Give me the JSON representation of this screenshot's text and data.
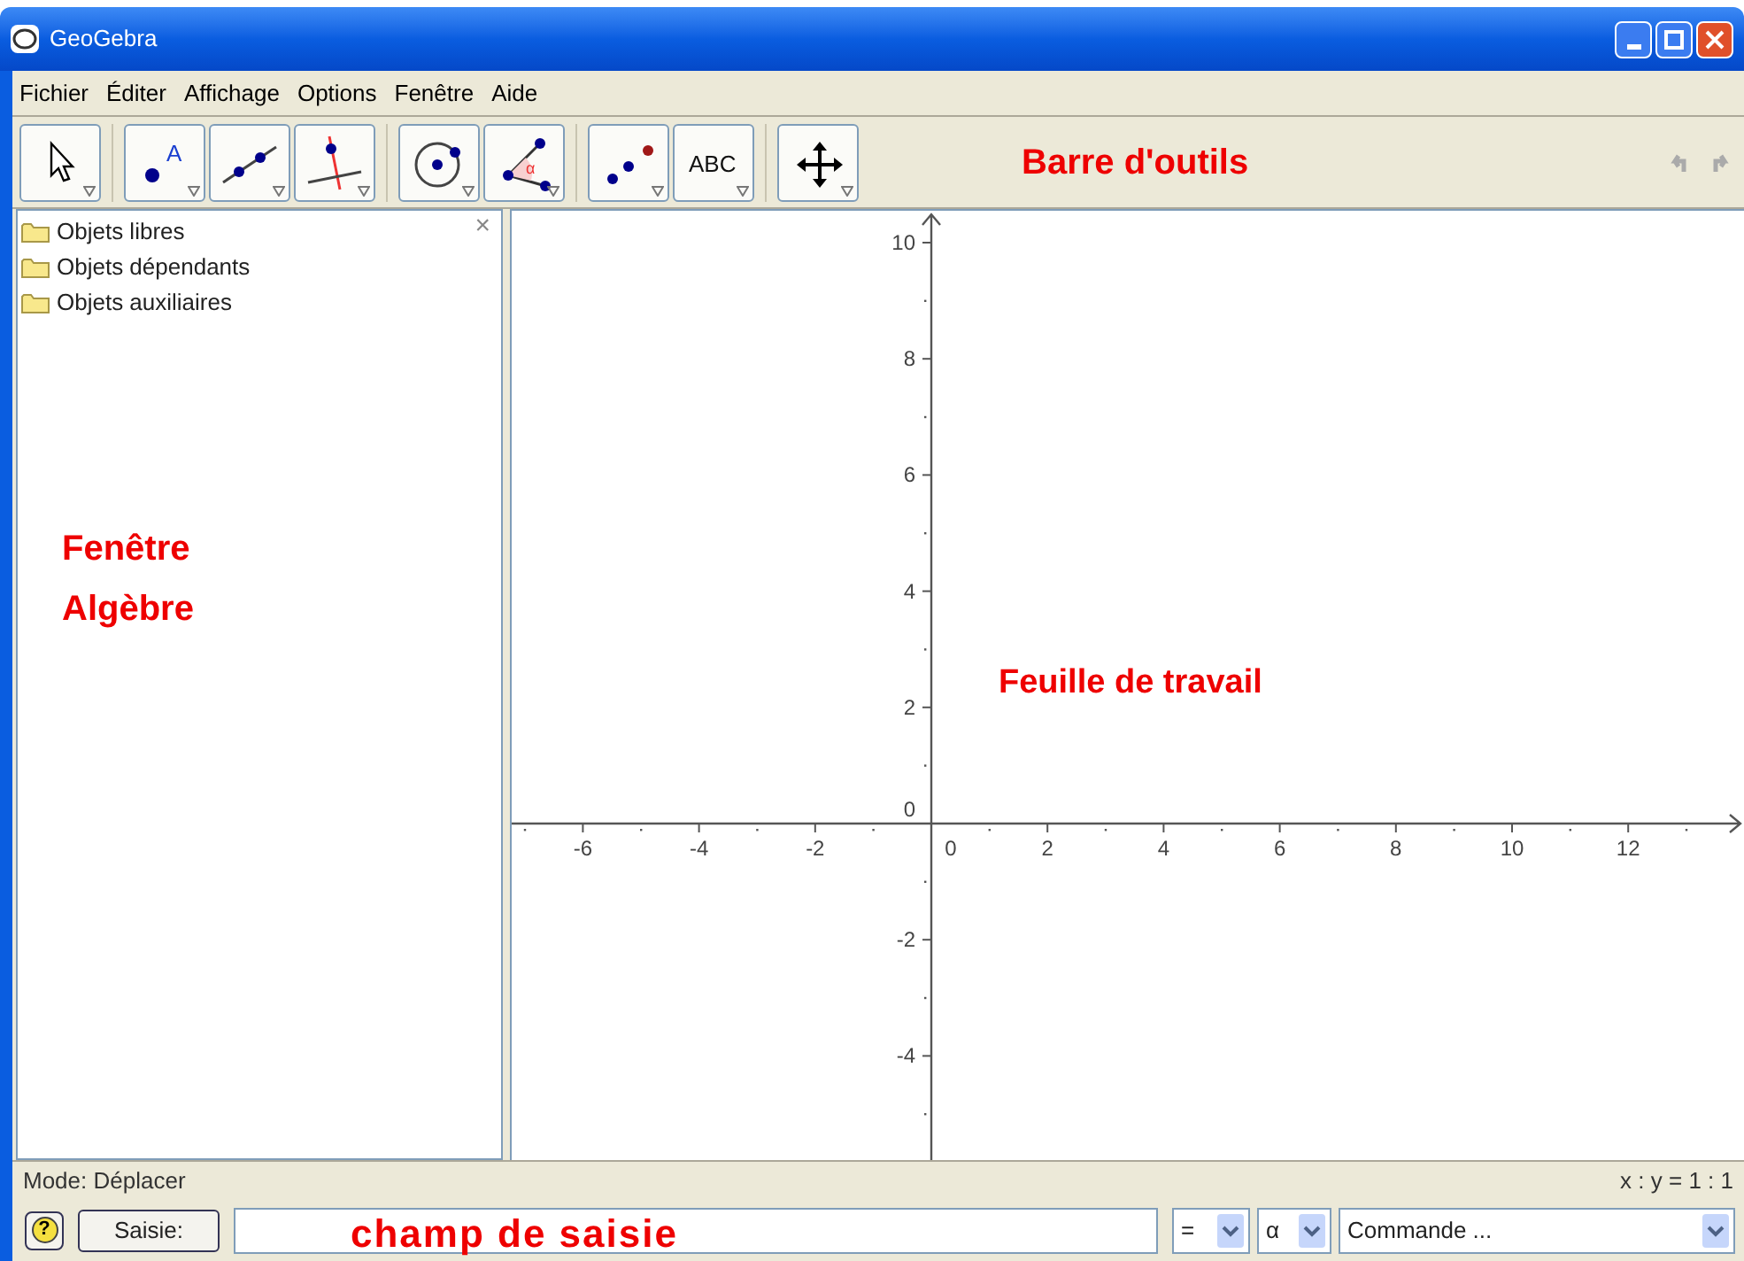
{
  "window": {
    "title": "GeoGebra"
  },
  "menu": [
    "Fichier",
    "Éditer",
    "Affichage",
    "Options",
    "Fenêtre",
    "Aide"
  ],
  "toolbar": {
    "groups": [
      [
        {
          "kind": "move"
        }
      ],
      [
        {
          "kind": "point",
          "label": "A"
        },
        {
          "kind": "line"
        },
        {
          "kind": "perpendicular"
        }
      ],
      [
        {
          "kind": "circle"
        },
        {
          "kind": "angle",
          "label": "α"
        }
      ],
      [
        {
          "kind": "reflect"
        },
        {
          "kind": "text",
          "label": "ABC"
        }
      ],
      [
        {
          "kind": "pan"
        }
      ]
    ],
    "annotation": "Barre d'outils"
  },
  "algebra_view": {
    "items": [
      {
        "label": "Objets libres"
      },
      {
        "label": "Objets dépendants"
      },
      {
        "label": "Objets auxiliaires"
      }
    ],
    "close": "×",
    "annotation": [
      "Fenêtre",
      "Algèbre"
    ]
  },
  "graphics_view": {
    "x_labels": [
      "-6",
      "-4",
      "-2",
      "0",
      "2",
      "4",
      "6",
      "8",
      "10",
      "12"
    ],
    "y_labels": [
      "10",
      "8",
      "6",
      "4",
      "2",
      "0",
      "-2",
      "-4"
    ],
    "annotation": "Feuille de travail"
  },
  "status_bar": {
    "mode": "Mode: Déplacer",
    "ratio": "x : y = 1 : 1"
  },
  "input_bar": {
    "help": "?",
    "button": "Saisie:",
    "annotation": "champ de saisie",
    "selects": [
      "=",
      "α",
      "Commande ..."
    ]
  }
}
